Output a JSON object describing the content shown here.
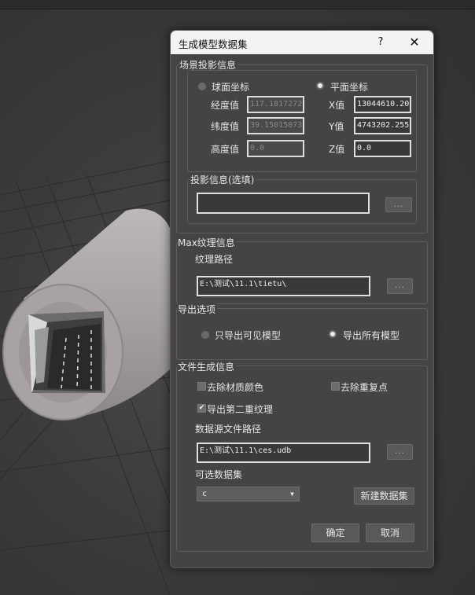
{
  "dialog": {
    "title": "生成模型数据集",
    "help_label": "?",
    "close_label": "✕"
  },
  "scene": {
    "legend": "场景投影信息",
    "spherical_label": "球面坐标",
    "spherical_selected": false,
    "planar_label": "平面坐标",
    "planar_selected": true,
    "longitude_label": "经度值",
    "longitude_value": "117.1817272",
    "latitude_label": "纬度值",
    "latitude_value": "39.15015073",
    "height_label": "高度值",
    "height_value": "0.0",
    "x_label": "X值",
    "x_value": "13044610.20",
    "y_label": "Y值",
    "y_value": "4743202.255",
    "z_label": "Z值",
    "z_value": "0.0"
  },
  "projection": {
    "legend": "投影信息(选填)",
    "value": "",
    "browse_label": "..."
  },
  "texture": {
    "legend": "Max纹理信息",
    "path_label": "纹理路径",
    "path_value": "E:\\测试\\11.1\\tietu\\",
    "browse_label": "..."
  },
  "export": {
    "legend": "导出选项",
    "visible_only_label": "只导出可见模型",
    "visible_only_selected": false,
    "all_models_label": "导出所有模型",
    "all_models_selected": true
  },
  "file_gen": {
    "legend": "文件生成信息",
    "remove_material_color_label": "去除材质颜色",
    "remove_material_color_checked": false,
    "remove_duplicate_points_label": "去除重复点",
    "remove_duplicate_points_checked": false,
    "export_second_texture_label": "导出第二重纹理",
    "export_second_texture_checked": true,
    "datasource_path_label": "数据源文件路径",
    "datasource_path_value": "E:\\测试\\11.1\\ces.udb",
    "browse_label": "...",
    "dataset_label": "可选数据集",
    "dataset_selected": "c",
    "new_dataset_label": "新建数据集"
  },
  "footer": {
    "ok_label": "确定",
    "cancel_label": "取消"
  },
  "colors": {
    "dialog_bg": "#444444",
    "titlebar_bg": "#f3f3f3",
    "field_border": "#e0e0e0"
  },
  "icons": {
    "checkmark": "check-icon",
    "dropdown": "chevron-down-icon",
    "close": "close-icon",
    "help": "help-icon"
  }
}
